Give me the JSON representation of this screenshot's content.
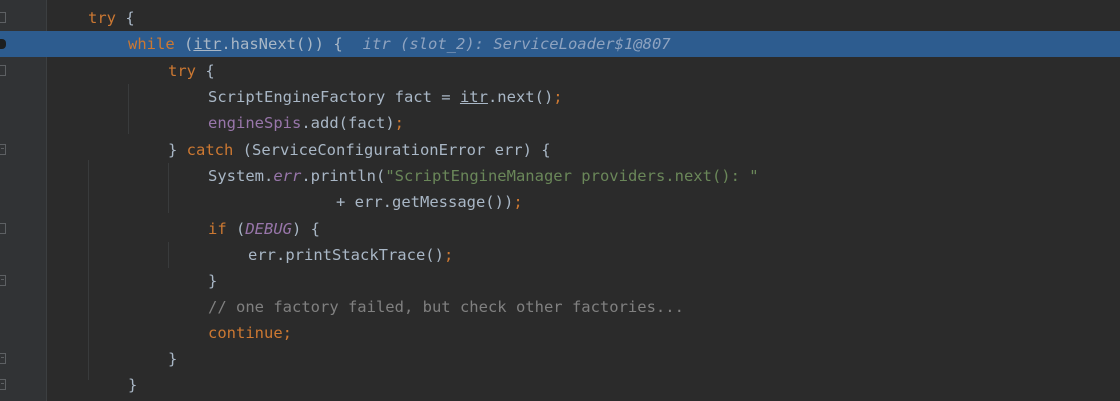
{
  "editor": {
    "lines": [
      {
        "tokens": [
          {
            "t": "try",
            "c": "kw"
          },
          {
            "t": " {",
            "c": ""
          }
        ]
      },
      {
        "tokens": [
          {
            "t": "while",
            "c": "kw"
          },
          {
            "t": " (",
            "c": ""
          },
          {
            "t": "itr",
            "c": "ul"
          },
          {
            "t": ".hasNext()) {",
            "c": ""
          }
        ],
        "hint": "itr (slot_2): ServiceLoader$1@807"
      },
      {
        "tokens": [
          {
            "t": "try",
            "c": "kw"
          },
          {
            "t": " {",
            "c": ""
          }
        ]
      },
      {
        "tokens": [
          {
            "t": "ScriptEngineFactory fact = ",
            "c": ""
          },
          {
            "t": "itr",
            "c": "ul"
          },
          {
            "t": ".next()",
            "c": ""
          },
          {
            "t": ";",
            "c": "kw"
          }
        ]
      },
      {
        "tokens": [
          {
            "t": "engineSpis",
            "c": "fld"
          },
          {
            "t": ".add(fact)",
            "c": ""
          },
          {
            "t": ";",
            "c": "kw"
          }
        ]
      },
      {
        "tokens": [
          {
            "t": "} ",
            "c": ""
          },
          {
            "t": "catch",
            "c": "kw"
          },
          {
            "t": " (ServiceConfigurationError err) {",
            "c": ""
          }
        ]
      },
      {
        "tokens": [
          {
            "t": "System.",
            "c": ""
          },
          {
            "t": "err",
            "c": "sfld"
          },
          {
            "t": ".println(",
            "c": ""
          },
          {
            "t": "\"ScriptEngineManager providers.next(): \"",
            "c": "str"
          }
        ]
      },
      {
        "tokens": [
          {
            "t": "+ err.getMessage())",
            "c": ""
          },
          {
            "t": ";",
            "c": "kw"
          }
        ]
      },
      {
        "tokens": [
          {
            "t": "if",
            "c": "kw"
          },
          {
            "t": " (",
            "c": ""
          },
          {
            "t": "DEBUG",
            "c": "sfld"
          },
          {
            "t": ") {",
            "c": ""
          }
        ]
      },
      {
        "tokens": [
          {
            "t": "err.printStackTrace()",
            "c": ""
          },
          {
            "t": ";",
            "c": "kw"
          }
        ]
      },
      {
        "tokens": [
          {
            "t": "}",
            "c": ""
          }
        ]
      },
      {
        "tokens": [
          {
            "t": "// one factory failed, but check other factories...",
            "c": "cmt"
          }
        ]
      },
      {
        "tokens": [
          {
            "t": "continue;",
            "c": "kw"
          }
        ]
      },
      {
        "tokens": [
          {
            "t": "}",
            "c": ""
          }
        ]
      },
      {
        "tokens": [
          {
            "t": "}",
            "c": ""
          }
        ]
      }
    ]
  },
  "colors": {
    "background": "#2b2b2b",
    "current_line": "#2d5c8f",
    "keyword": "#cc7832",
    "string": "#6a8759",
    "field": "#9876aa",
    "comment": "#808080"
  }
}
